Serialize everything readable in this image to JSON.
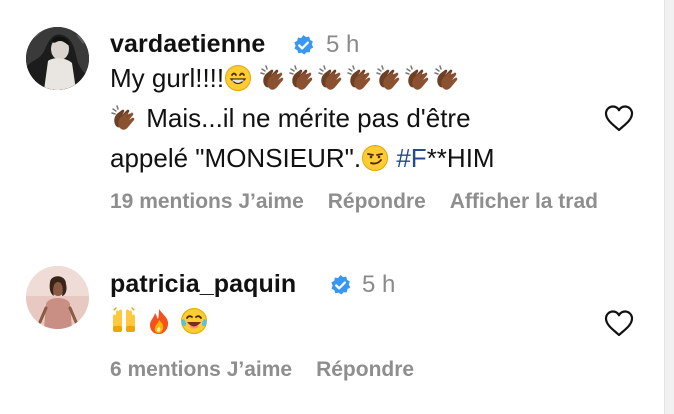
{
  "comments": [
    {
      "username": "vardaetienne",
      "time": "5 h",
      "text": {
        "line1_prefix": "My gurl!!!!",
        "line2": "Mais...il ne mérite pas d'être",
        "line3": "appelé \"MONSIEUR\".",
        "hashtag_hash": "#F",
        "hashtag_rest": "**HIM"
      },
      "emojis": [
        "grinning-face-with-smiling-eyes",
        "clapping-hands-dark-skin",
        "smirking-face"
      ],
      "likes_label": "19 mentions J’aime",
      "reply_label": "Répondre",
      "translate_label": "Afficher la trad"
    },
    {
      "username": "patricia_paquin",
      "time": "5 h",
      "emojis": [
        "raising-hands",
        "fire",
        "face-with-tears-of-joy"
      ],
      "likes_label": "6 mentions J’aime",
      "reply_label": "Répondre"
    }
  ],
  "colors": {
    "text": "#111111",
    "muted": "#8e8e8e",
    "hashtag": "#274a8f",
    "verified": "#3897f0"
  }
}
